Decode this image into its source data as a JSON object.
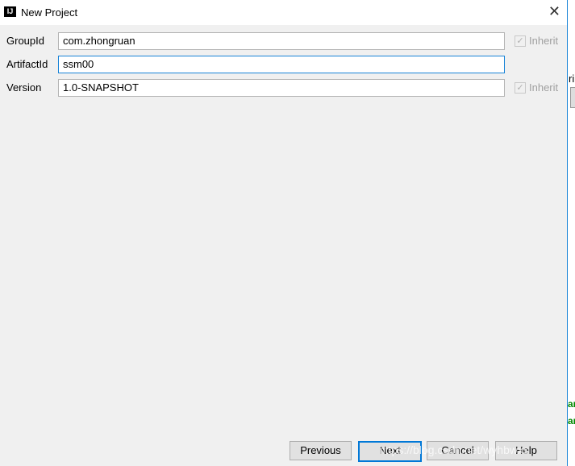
{
  "window": {
    "title": "New Project",
    "logo": "IJ"
  },
  "form": {
    "group_id": {
      "label": "GroupId",
      "value": "com.zhongruan",
      "inherit_label": "Inherit",
      "inherit_checked": true
    },
    "artifact_id": {
      "label": "ArtifactId",
      "value": "ssm00"
    },
    "version": {
      "label": "Version",
      "value": "1.0-SNAPSHOT",
      "inherit_label": "Inherit",
      "inherit_checked": true
    }
  },
  "buttons": {
    "previous": "Previous",
    "next": "Next",
    "cancel": "Cancel",
    "help": "Help"
  },
  "background": {
    "partial_text": "ri",
    "green_text_1": "an",
    "green_text_2": "an"
  },
  "watermark": "https://blog.csdn.net/wyhbwxs",
  "colors": {
    "accent": "#1883d7"
  }
}
